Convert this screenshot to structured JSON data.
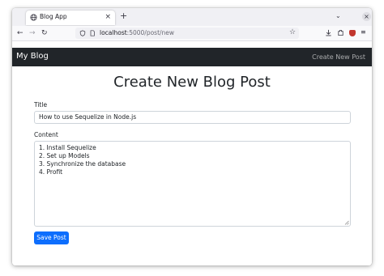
{
  "browser": {
    "tab_title": "Blog App",
    "tab_icon": "globe-icon",
    "close_tab_glyph": "×",
    "new_tab_glyph": "+",
    "url_host": "localhost",
    "url_path": ":5000/post/new"
  },
  "app": {
    "brand": "My Blog",
    "nav_link": "Create New Post"
  },
  "form": {
    "heading": "Create New Blog Post",
    "title_label": "Title",
    "title_value": "How to use Sequelize in Node.js",
    "content_label": "Content",
    "content_lines": [
      "1. Install Sequelize",
      "2. Set up Models",
      "3. Synchronize the database",
      "4. Profit"
    ],
    "save_label": "Save Post"
  },
  "colors": {
    "navbar_bg": "#212529",
    "button_bg": "#0d6efd"
  }
}
